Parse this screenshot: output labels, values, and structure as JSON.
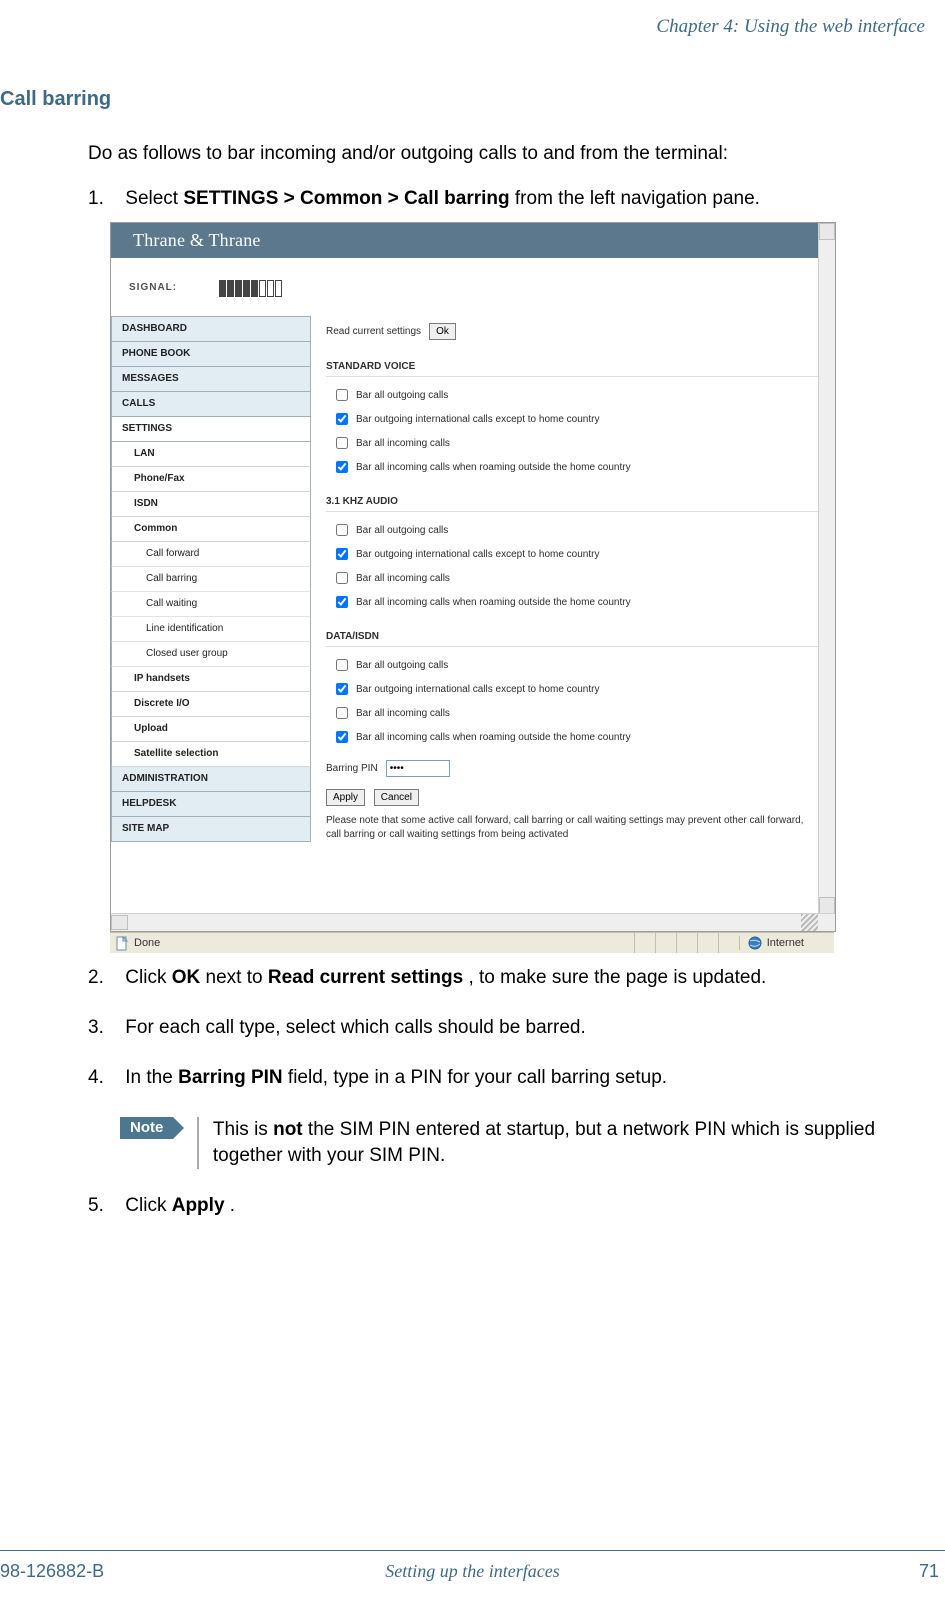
{
  "chapter_header": "Chapter 4: Using the web interface",
  "section_title": "Call barring",
  "intro": "Do as follows to bar incoming and/or outgoing calls to and from the terminal:",
  "steps": {
    "s1_num": "1.",
    "s1_pre": "Select ",
    "s1_bold": "SETTINGS > Common > Call barring",
    "s1_post": " from the left navigation pane.",
    "s2_num": "2.",
    "s2_pre": "Click ",
    "s2_b1": "OK",
    "s2_mid": " next to ",
    "s2_b2": "Read current settings",
    "s2_post": ", to make sure the page is updated.",
    "s3_num": "3.",
    "s3_text": "For each call type, select which calls should be barred.",
    "s4_num": "4.",
    "s4_pre": "In the ",
    "s4_bold": "Barring PIN",
    "s4_post": " field, type in a PIN for your call barring setup.",
    "s5_num": "5.",
    "s5_pre": "Click ",
    "s5_bold": "Apply",
    "s5_post": "."
  },
  "note": {
    "label": "Note",
    "pre": "This is ",
    "bold": "not",
    "post": " the SIM PIN entered at startup, but a network PIN which is supplied together with your SIM PIN."
  },
  "footer": {
    "left": "98-126882-B",
    "center": "Setting up the interfaces",
    "page": "71"
  },
  "screenshot": {
    "logo": "Thrane & Thrane",
    "signal_label": "SIGNAL:",
    "signal_bars": {
      "filled": 5,
      "total": 8
    },
    "nav": {
      "dashboard": "DASHBOARD",
      "phonebook": "PHONE BOOK",
      "messages": "MESSAGES",
      "calls": "CALLS",
      "settings": "SETTINGS",
      "lan": "LAN",
      "phonefax": "Phone/Fax",
      "isdn": "ISDN",
      "common": "Common",
      "call_forward": "Call forward",
      "call_barring": "Call barring",
      "call_waiting": "Call waiting",
      "line_ident": "Line identification",
      "closed_ug": "Closed user group",
      "ip_handsets": "IP handsets",
      "discrete_io": "Discrete I/O",
      "upload": "Upload",
      "sat_sel": "Satellite selection",
      "admin": "ADMINISTRATION",
      "helpdesk": "HELPDESK",
      "sitemap": "SITE MAP"
    },
    "pane": {
      "read_label": "Read current settings",
      "ok": "Ok",
      "sect1": "STANDARD VOICE",
      "sect2": "3.1 KHZ AUDIO",
      "sect3": "DATA/ISDN",
      "opt1": "Bar all outgoing calls",
      "opt2": "Bar outgoing international calls except to home country",
      "opt3": "Bar all incoming calls",
      "opt4": "Bar all incoming calls when roaming outside the home country",
      "pin_label": "Barring PIN",
      "pin_value": "••••",
      "apply": "Apply",
      "cancel": "Cancel",
      "note": "Please note that some active call forward, call barring or call waiting settings may prevent other call forward, call barring or call waiting settings from being activated"
    },
    "statusbar": {
      "done": "Done",
      "zone": "Internet"
    }
  }
}
